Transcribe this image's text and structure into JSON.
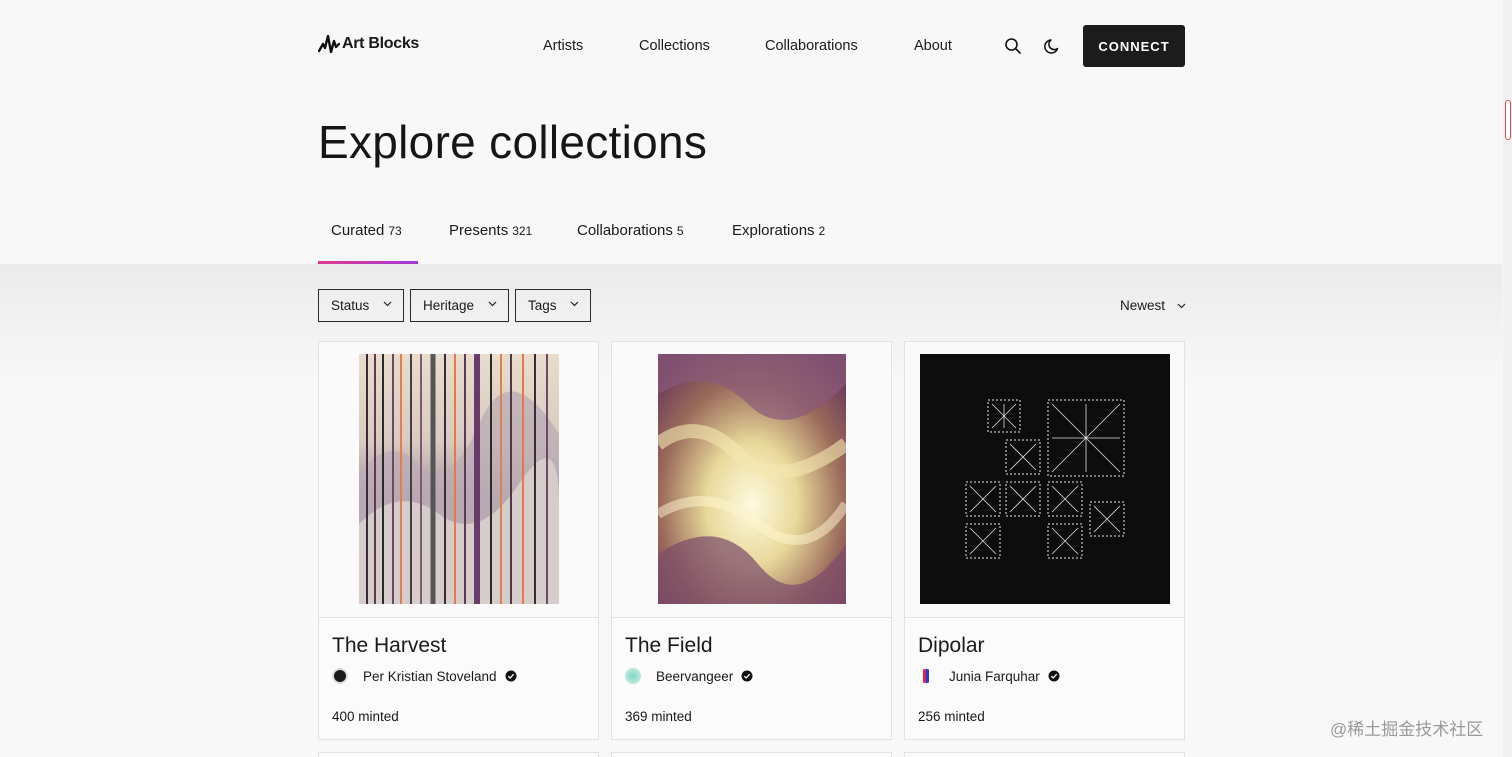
{
  "header": {
    "logo_text": "Art Blocks",
    "nav": [
      "Artists",
      "Collections",
      "Collaborations",
      "About"
    ],
    "search_icon": "search-icon",
    "theme_icon": "moon-icon",
    "connect_label": "CONNECT"
  },
  "page": {
    "title": "Explore collections"
  },
  "tabs": [
    {
      "label": "Curated",
      "count": "73",
      "active": true
    },
    {
      "label": "Presents",
      "count": "321",
      "active": false
    },
    {
      "label": "Collaborations",
      "count": "5",
      "active": false
    },
    {
      "label": "Explorations",
      "count": "2",
      "active": false
    }
  ],
  "filters": {
    "items": [
      "Status",
      "Heritage",
      "Tags"
    ],
    "sort_label": "Newest"
  },
  "cards": [
    {
      "title": "The Harvest",
      "artist": "Per Kristian Stoveland",
      "minted": "400 minted",
      "verified": true
    },
    {
      "title": "The Field",
      "artist": "Beervangeer",
      "minted": "369 minted",
      "verified": true
    },
    {
      "title": "Dipolar",
      "artist": "Junia Farquhar",
      "minted": "256 minted",
      "verified": true
    }
  ],
  "watermark": "@稀土掘金技术社区",
  "colors": {
    "accent_gradient_start": "#e03a8f",
    "accent_gradient_end": "#a13ad8",
    "button_dark": "#1c1c1c"
  }
}
